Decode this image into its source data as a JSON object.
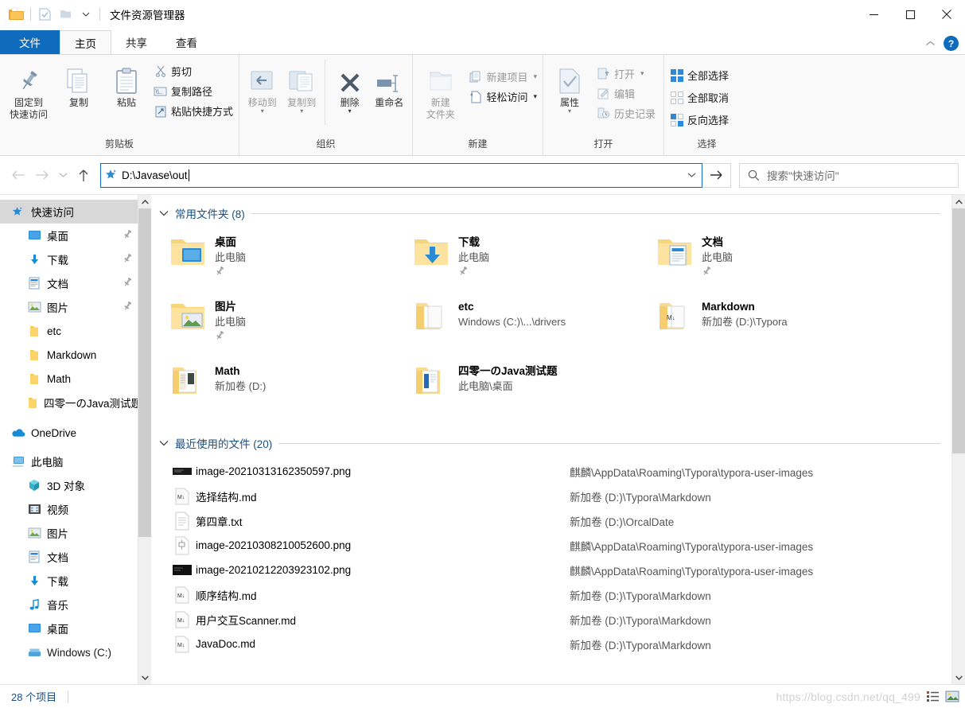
{
  "window": {
    "title": "文件资源管理器",
    "quick_access_icons": [
      "folder-icon",
      "properties-icon",
      "new-folder-icon",
      "chevron-down-icon"
    ],
    "controls": {
      "minimize": "—",
      "maximize": "▢",
      "close": "✕"
    }
  },
  "tabs": {
    "items": [
      {
        "label": "文件",
        "kind": "file"
      },
      {
        "label": "主页",
        "kind": "active"
      },
      {
        "label": "共享",
        "kind": "normal"
      },
      {
        "label": "查看",
        "kind": "normal"
      }
    ],
    "collapse_icon": "chevron-up-icon",
    "help_label": "?"
  },
  "ribbon": {
    "groups": [
      {
        "name": "clipboard",
        "label": "剪贴板",
        "big_buttons": [
          {
            "label": "固定到\n快速访问",
            "icon": "pin-icon",
            "lines": [
              "固定到",
              "快速访问"
            ]
          },
          {
            "label": "复制",
            "icon": "copy-icon",
            "lines": [
              "复制"
            ]
          },
          {
            "label": "粘贴",
            "icon": "paste-icon",
            "lines": [
              "粘贴"
            ],
            "caret": true
          }
        ],
        "small_buttons": [
          {
            "label": "剪切",
            "icon": "scissors-icon",
            "dim": false
          },
          {
            "label": "复制路径",
            "icon": "copy-path-icon",
            "dim": false
          },
          {
            "label": "粘贴快捷方式",
            "icon": "paste-shortcut-icon",
            "dim": false
          }
        ]
      },
      {
        "name": "organize",
        "label": "组织",
        "big_buttons": [
          {
            "label": "移动到",
            "icon": "move-to-icon",
            "lines": [
              "移动到"
            ],
            "caret": true,
            "dim": true
          },
          {
            "label": "复制到",
            "icon": "copy-to-icon",
            "lines": [
              "复制到"
            ],
            "caret": true,
            "dim": true
          },
          {
            "label": "删除",
            "icon": "delete-x-icon",
            "lines": [
              "删除"
            ],
            "caret": true
          },
          {
            "label": "重命名",
            "icon": "rename-icon",
            "lines": [
              "重命名"
            ]
          }
        ],
        "small_buttons": []
      },
      {
        "name": "new",
        "label": "新建",
        "big_buttons": [
          {
            "label": "新建\n文件夹",
            "icon": "new-folder-big-icon",
            "lines": [
              "新建",
              "文件夹"
            ],
            "dim": true
          }
        ],
        "small_buttons": [
          {
            "label": "新建项目",
            "icon": "new-item-icon",
            "dim": true,
            "caret": true
          },
          {
            "label": "轻松访问",
            "icon": "easy-access-icon",
            "dim": false,
            "caret": true
          }
        ]
      },
      {
        "name": "open",
        "label": "打开",
        "big_buttons": [
          {
            "label": "属性",
            "icon": "properties-big-icon",
            "lines": [
              "属性"
            ],
            "caret": true
          }
        ],
        "small_buttons": [
          {
            "label": "打开",
            "icon": "open-icon",
            "dim": true,
            "caret": true
          },
          {
            "label": "编辑",
            "icon": "edit-icon",
            "dim": true
          },
          {
            "label": "历史记录",
            "icon": "history-icon",
            "dim": true
          }
        ]
      },
      {
        "name": "select",
        "label": "选择",
        "big_buttons": [],
        "small_buttons": [
          {
            "label": "全部选择",
            "icon": "select-all-icon",
            "dim": false
          },
          {
            "label": "全部取消",
            "icon": "select-none-icon",
            "dim": false
          },
          {
            "label": "反向选择",
            "icon": "invert-selection-icon",
            "dim": false
          }
        ]
      }
    ]
  },
  "navbar": {
    "back_icon": "arrow-left-icon",
    "forward_icon": "arrow-right-icon",
    "recent_icon": "chevron-down-icon",
    "up_icon": "arrow-up-icon",
    "address_icon": "quick-access-star-icon",
    "address_value": "D:\\Javase\\out",
    "address_dropdown_icon": "chevron-down-icon",
    "go_icon": "arrow-right-icon",
    "search_icon": "search-icon",
    "search_placeholder": "搜索\"快速访问\""
  },
  "sidebar": {
    "items": [
      {
        "label": "快速访问",
        "icon": "quick-access-star-icon",
        "level": 0,
        "selected": true,
        "pinned": false
      },
      {
        "label": "桌面",
        "icon": "desktop-icon",
        "level": 1,
        "selected": false,
        "pinned": true
      },
      {
        "label": "下载",
        "icon": "downloads-icon",
        "level": 1,
        "selected": false,
        "pinned": true
      },
      {
        "label": "文档",
        "icon": "documents-icon",
        "level": 1,
        "selected": false,
        "pinned": true
      },
      {
        "label": "图片",
        "icon": "pictures-icon",
        "level": 1,
        "selected": false,
        "pinned": true
      },
      {
        "label": "etc",
        "icon": "folder-icon",
        "level": 1,
        "selected": false,
        "pinned": false
      },
      {
        "label": "Markdown",
        "icon": "folder-icon",
        "level": 1,
        "selected": false,
        "pinned": false
      },
      {
        "label": "Math",
        "icon": "folder-icon",
        "level": 1,
        "selected": false,
        "pinned": false
      },
      {
        "label": "四零一のJava测试题",
        "icon": "folder-icon",
        "level": 1,
        "selected": false,
        "pinned": false
      },
      {
        "label": "OneDrive",
        "icon": "onedrive-icon",
        "level": 0,
        "selected": false,
        "pinned": false
      },
      {
        "label": "此电脑",
        "icon": "this-pc-icon",
        "level": 0,
        "selected": false,
        "pinned": false
      },
      {
        "label": "3D 对象",
        "icon": "3d-objects-icon",
        "level": 1,
        "selected": false,
        "pinned": false
      },
      {
        "label": "视频",
        "icon": "videos-icon",
        "level": 1,
        "selected": false,
        "pinned": false
      },
      {
        "label": "图片",
        "icon": "pictures-icon",
        "level": 1,
        "selected": false,
        "pinned": false
      },
      {
        "label": "文档",
        "icon": "documents-icon",
        "level": 1,
        "selected": false,
        "pinned": false
      },
      {
        "label": "下载",
        "icon": "downloads-icon",
        "level": 1,
        "selected": false,
        "pinned": false
      },
      {
        "label": "音乐",
        "icon": "music-icon",
        "level": 1,
        "selected": false,
        "pinned": false
      },
      {
        "label": "桌面",
        "icon": "desktop-icon",
        "level": 1,
        "selected": false,
        "pinned": false
      },
      {
        "label": "Windows (C:)",
        "icon": "drive-icon",
        "level": 1,
        "selected": false,
        "pinned": false
      }
    ]
  },
  "content": {
    "frequent_section": {
      "title": "常用文件夹 (8)",
      "items": [
        {
          "name": "桌面",
          "sub": "此电脑",
          "icon": "folder-desktop-icon",
          "pinned": true
        },
        {
          "name": "下载",
          "sub": "此电脑",
          "icon": "folder-downloads-icon",
          "pinned": true
        },
        {
          "name": "文档",
          "sub": "此电脑",
          "icon": "folder-documents-icon",
          "pinned": true
        },
        {
          "name": "图片",
          "sub": "此电脑",
          "icon": "folder-pictures-icon",
          "pinned": true
        },
        {
          "name": "etc",
          "sub": "Windows (C:)\\...\\drivers",
          "icon": "folder-files-icon",
          "pinned": false
        },
        {
          "name": "Markdown",
          "sub": "新加卷 (D:)\\Typora",
          "icon": "folder-markdown-icon",
          "pinned": false
        },
        {
          "name": "Math",
          "sub": "新加卷 (D:)",
          "icon": "folder-math-icon",
          "pinned": false
        },
        {
          "name": "四零一のJava测试题",
          "sub": "此电脑\\桌面",
          "icon": "folder-docs-icon",
          "pinned": false
        }
      ]
    },
    "recent_section": {
      "title": "最近使用的文件 (20)",
      "items": [
        {
          "name": "image-20210313162350597.png",
          "path": "麒麟\\AppData\\Roaming\\Typora\\typora-user-images",
          "icon": "image-dark-icon"
        },
        {
          "name": "选择结构.md",
          "path": "新加卷 (D:)\\Typora\\Markdown",
          "icon": "markdown-icon"
        },
        {
          "name": "第四章.txt",
          "path": "新加卷 (D:)\\OrcalDate",
          "icon": "text-file-icon"
        },
        {
          "name": "image-20210308210052600.png",
          "path": "麒麟\\AppData\\Roaming\\Typora\\typora-user-images",
          "icon": "image-light-icon"
        },
        {
          "name": "image-20210212203923102.png",
          "path": "麒麟\\AppData\\Roaming\\Typora\\typora-user-images",
          "icon": "image-dark-icon"
        },
        {
          "name": "顺序结构.md",
          "path": "新加卷 (D:)\\Typora\\Markdown",
          "icon": "markdown-icon"
        },
        {
          "name": "用户交互Scanner.md",
          "path": "新加卷 (D:)\\Typora\\Markdown",
          "icon": "markdown-icon"
        },
        {
          "name": "JavaDoc.md",
          "path": "新加卷 (D:)\\Typora\\Markdown",
          "icon": "markdown-icon"
        }
      ]
    }
  },
  "status": {
    "item_count": "28 个项目",
    "watermark": "https://blog.csdn.net/qq_499",
    "view_buttons": [
      "details-view-icon",
      "large-icons-view-icon"
    ]
  },
  "colors": {
    "accent": "#0f6cbd",
    "section_title": "#1a4f82",
    "ribbon_bg": "#f9f9f9",
    "selection": "#d8d8d8",
    "folder_yellow": "#fbd46a"
  }
}
